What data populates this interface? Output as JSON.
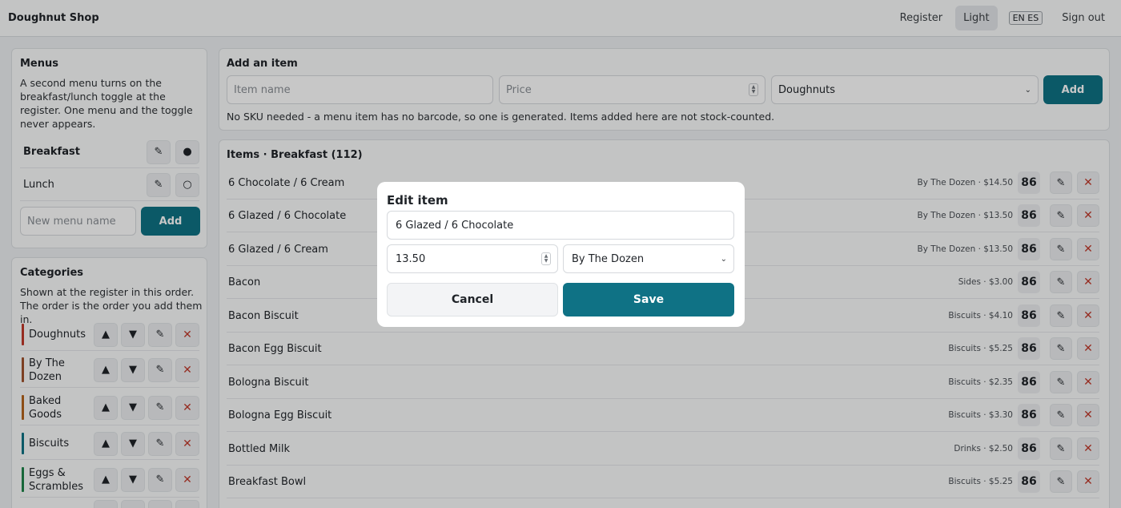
{
  "app": {
    "title": "Doughnut Shop"
  },
  "topnav": {
    "register": "Register",
    "light": "Light",
    "lang": "EN ES",
    "signout": "Sign out"
  },
  "menus": {
    "title": "Menus",
    "desc": "A second menu turns on the breakfast/lunch toggle at the register. One menu and the toggle never appears.",
    "items": [
      {
        "name": "Breakfast",
        "active": true
      },
      {
        "name": "Lunch",
        "active": false
      }
    ],
    "new_placeholder": "New menu name",
    "add_label": "Add"
  },
  "categories": {
    "title": "Categories",
    "desc": "Shown at the register in this order. The order is the order you add them in.",
    "items": [
      {
        "name": "Doughnuts",
        "color": "#c0392b"
      },
      {
        "name": "By The Dozen",
        "color": "#a0522d"
      },
      {
        "name": "Baked Goods",
        "color": "#b5651d"
      },
      {
        "name": "Biscuits",
        "color": "#0f7285"
      },
      {
        "name": "Eggs & Scrambles",
        "color": "#1e8449"
      }
    ]
  },
  "add_item": {
    "title": "Add an item",
    "name_placeholder": "Item name",
    "price_placeholder": "Price",
    "category": "Doughnuts",
    "add_label": "Add",
    "note": "No SKU needed - a menu item has no barcode, so one is generated. Items added here are not stock-counted."
  },
  "items": {
    "title": "Items · Breakfast (112)",
    "badge": "86",
    "rows": [
      {
        "name": "6 Chocolate / 6 Cream",
        "meta": "By The Dozen · $14.50"
      },
      {
        "name": "6 Glazed / 6 Chocolate",
        "meta": "By The Dozen · $13.50"
      },
      {
        "name": "6 Glazed / 6 Cream",
        "meta": "By The Dozen · $13.50"
      },
      {
        "name": "Bacon",
        "meta": "Sides · $3.00"
      },
      {
        "name": "Bacon Biscuit",
        "meta": "Biscuits · $4.10"
      },
      {
        "name": "Bacon Egg Biscuit",
        "meta": "Biscuits · $5.25"
      },
      {
        "name": "Bologna Biscuit",
        "meta": "Biscuits · $2.35"
      },
      {
        "name": "Bologna Egg Biscuit",
        "meta": "Biscuits · $3.30"
      },
      {
        "name": "Bottled Milk",
        "meta": "Drinks · $2.50"
      },
      {
        "name": "Breakfast Bowl",
        "meta": "Biscuits · $5.25"
      }
    ]
  },
  "modal": {
    "title": "Edit item",
    "name_value": "6 Glazed / 6 Chocolate",
    "price_value": "13.50",
    "category_value": "By The Dozen",
    "cancel_label": "Cancel",
    "save_label": "Save"
  },
  "colors": {
    "accent": "#0f7285",
    "danger": "#c0392b"
  }
}
